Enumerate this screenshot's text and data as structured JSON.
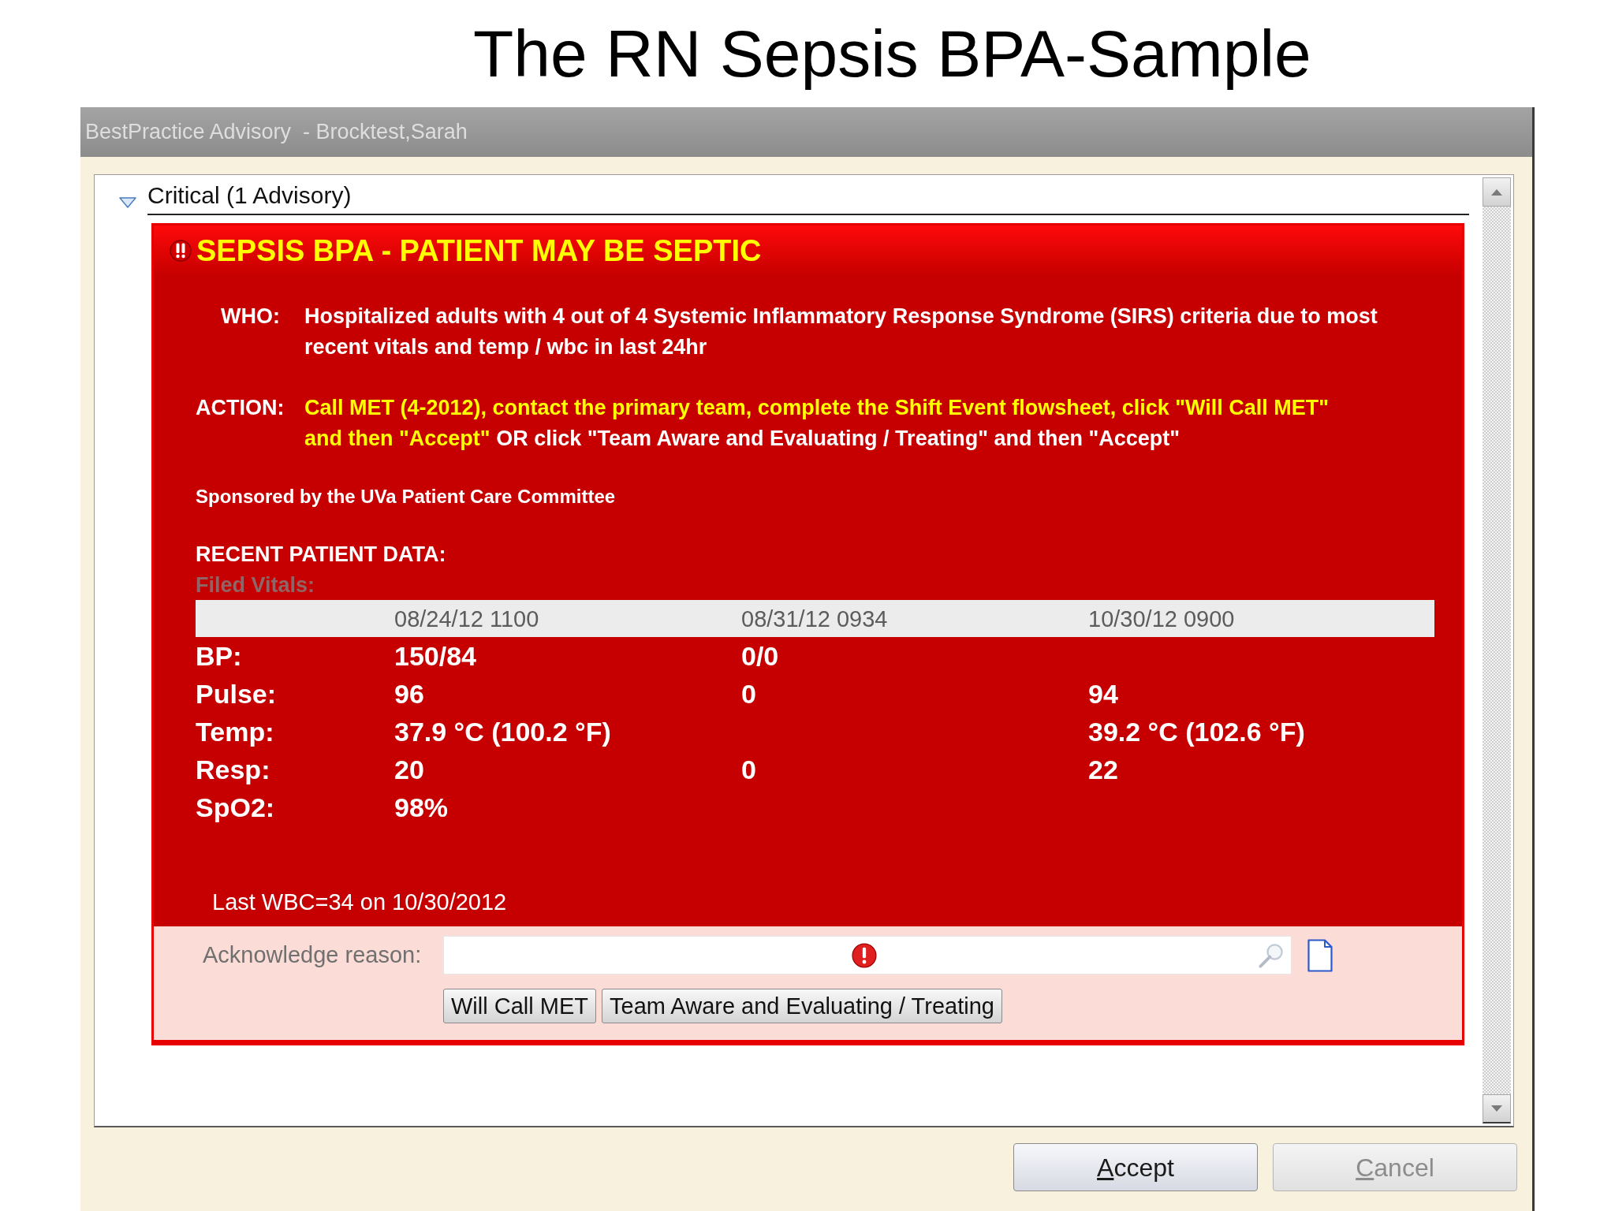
{
  "slide_title": "The RN Sepsis BPA-Sample",
  "window": {
    "title": "BestPractice Advisory  - Brocktest,Sarah"
  },
  "section": {
    "label": "Critical (1 Advisory)",
    "expanded": true
  },
  "advisory": {
    "title": "SEPSIS BPA - PATIENT MAY BE SEPTIC",
    "who": {
      "label": "WHO:",
      "text": "Hospitalized adults with 4 out of 4 Systemic Inflammatory Response Syndrome (SIRS) criteria due to most recent vitals and temp / wbc in last 24hr"
    },
    "action": {
      "label": "ACTION:",
      "segments": [
        {
          "text": "Call MET (4-2012), contact the primary team, complete the Shift Event flowsheet, click \"Will Call MET\" and then \"Accept\"",
          "emphasized": true
        },
        {
          "text": " OR click \"Team Aware and Evaluating / Treating\" and then \"Accept\"",
          "emphasized": false
        }
      ]
    },
    "sponsor": "Sponsored by the UVa Patient Care Committee",
    "recent_heading": "RECENT PATIENT DATA:",
    "vitals_heading": "Filed Vitals:",
    "vitals_table": {
      "columns": [
        "08/24/12 1100",
        "08/31/12 0934",
        "10/30/12 0900"
      ],
      "rows": [
        {
          "label": "BP:",
          "col_1": "150/84",
          "col_2": "0/0"
        },
        {
          "label": "Pulse:",
          "col_1": "96",
          "col_2": "0",
          "col_3": "94"
        },
        {
          "label": "Temp:",
          "col_1": "37.9 °C (100.2 °F)",
          "col_3": "39.2 °C (102.6 °F)"
        },
        {
          "label": "Resp:",
          "col_1": "20",
          "col_2": "0",
          "col_3": "22"
        },
        {
          "label": "SpO2:",
          "col_1": "98%"
        }
      ]
    },
    "last_wbc": "Last WBC=34 on 10/30/2012",
    "acknowledge": {
      "label": "Acknowledge reason:",
      "buttons": [
        "Will Call MET",
        "Team Aware and Evaluating / Treating"
      ]
    }
  },
  "footer_buttons": [
    {
      "label": "Accept",
      "disabled": false
    },
    {
      "label": "Cancel",
      "disabled": true
    }
  ]
}
